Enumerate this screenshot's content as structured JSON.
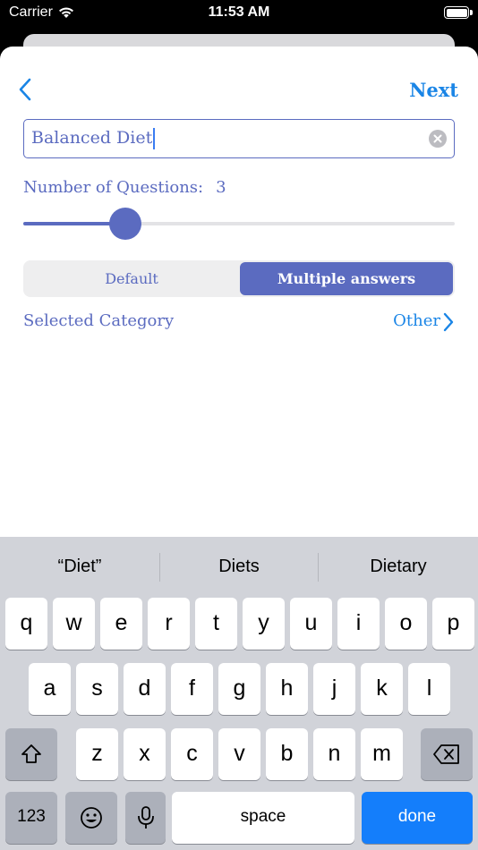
{
  "status_bar": {
    "carrier": "Carrier",
    "time": "11:53 AM",
    "icons": [
      "wifi-icon",
      "battery-icon"
    ]
  },
  "nav": {
    "back_icon": "chevron-left-icon",
    "next_label": "Next"
  },
  "title_field": {
    "value": "Balanced Diet",
    "clear_icon": "clear-icon"
  },
  "questions": {
    "label": "Number of Questions:",
    "count": "3",
    "slider_fraction": 0.22
  },
  "mode_segmented": {
    "options": [
      "Default",
      "Multiple answers"
    ],
    "selected": "Multiple answers"
  },
  "category": {
    "label": "Selected Category",
    "value": "Other",
    "chevron_icon": "chevron-right-icon"
  },
  "keyboard": {
    "predictions": [
      "“Diet”",
      "Diets",
      "Dietary"
    ],
    "row1": [
      "q",
      "w",
      "e",
      "r",
      "t",
      "y",
      "u",
      "i",
      "o",
      "p"
    ],
    "row2": [
      "a",
      "s",
      "d",
      "f",
      "g",
      "h",
      "j",
      "k",
      "l"
    ],
    "row3": [
      "z",
      "x",
      "c",
      "v",
      "b",
      "n",
      "m"
    ],
    "shift_icon": "shift-icon",
    "delete_icon": "delete-icon",
    "numbers_label": "123",
    "emoji_icon": "emoji-icon",
    "mic_icon": "microphone-icon",
    "space_label": "space",
    "done_label": "done"
  },
  "colors": {
    "accent": "#5b6bc0",
    "link": "#1a85e6",
    "keyboard_bg": "#d1d3d9",
    "done_key": "#147efb"
  }
}
